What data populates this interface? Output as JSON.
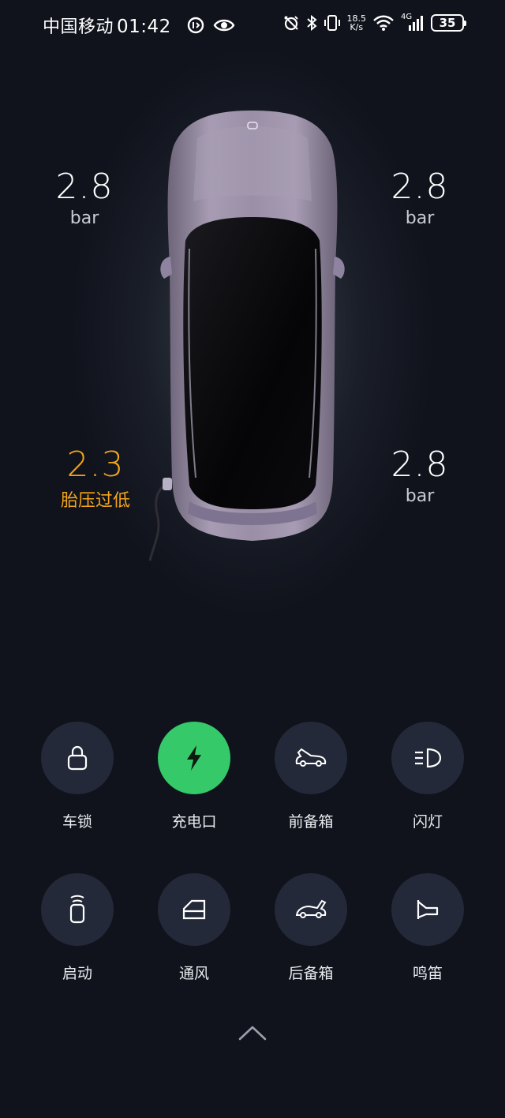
{
  "status_bar": {
    "carrier": "中国移动",
    "time": "01:42",
    "net_speed_value": "18.5",
    "net_speed_unit": "K/s",
    "network_type": "4G",
    "battery": "35",
    "icons_left": [
      "data-saver-icon",
      "eye-icon"
    ],
    "icons_right": [
      "alarm-off-icon",
      "bluetooth-icon",
      "vibrate-icon",
      "wifi-icon",
      "signal-icon",
      "battery-icon"
    ]
  },
  "tires": {
    "front_left": {
      "value": "2.8",
      "unit": "bar",
      "warning": false
    },
    "front_right": {
      "value": "2.8",
      "unit": "bar",
      "warning": false
    },
    "rear_left": {
      "value": "2.3",
      "unit": "胎压过低",
      "warning": true
    },
    "rear_right": {
      "value": "2.8",
      "unit": "bar",
      "warning": false
    }
  },
  "colors": {
    "background": "#10131c",
    "button_bg": "#232939",
    "active_green": "#35c96a",
    "warning_orange": "#f3a51b",
    "car_body": "#9a8fa6"
  },
  "controls": [
    {
      "label": "车锁",
      "icon": "lock-icon",
      "active": false
    },
    {
      "label": "充电口",
      "icon": "lightning-icon",
      "active": true
    },
    {
      "label": "前备箱",
      "icon": "front-trunk-icon",
      "active": false
    },
    {
      "label": "闪灯",
      "icon": "headlight-icon",
      "active": false
    },
    {
      "label": "启动",
      "icon": "car-key-icon",
      "active": false
    },
    {
      "label": "通风",
      "icon": "window-icon",
      "active": false
    },
    {
      "label": "后备箱",
      "icon": "rear-trunk-icon",
      "active": false
    },
    {
      "label": "鸣笛",
      "icon": "horn-icon",
      "active": false
    }
  ],
  "expand_icon": "chevron-up-icon"
}
